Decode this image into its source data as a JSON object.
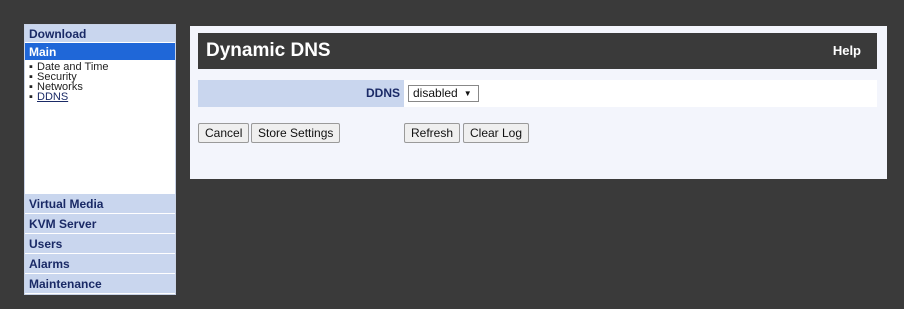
{
  "sidebar": {
    "download": "Download",
    "main": "Main",
    "sub_items": [
      {
        "label": "Date and Time"
      },
      {
        "label": "Security"
      },
      {
        "label": "Networks"
      },
      {
        "label": "DDNS"
      }
    ],
    "bottom_items": [
      {
        "label": "Virtual Media"
      },
      {
        "label": "KVM Server"
      },
      {
        "label": "Users"
      },
      {
        "label": "Alarms"
      },
      {
        "label": "Maintenance"
      }
    ]
  },
  "panel": {
    "title": "Dynamic DNS",
    "help": "Help",
    "ddns_label": "DDNS",
    "ddns_value": "disabled",
    "buttons": {
      "cancel": "Cancel",
      "store": "Store Settings",
      "refresh": "Refresh",
      "clear_log": "Clear Log"
    }
  }
}
